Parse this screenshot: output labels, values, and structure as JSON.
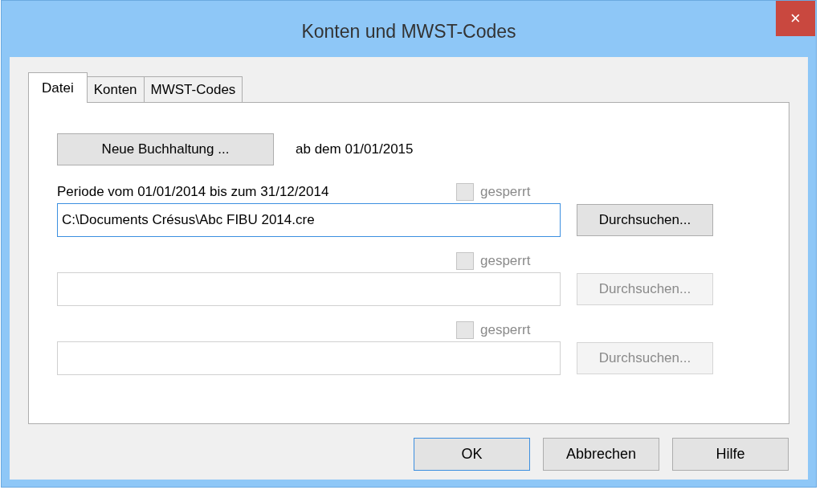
{
  "window": {
    "title": "Konten und MWST-Codes",
    "close": "×"
  },
  "tabs": [
    {
      "label": "Datei",
      "selected": true
    },
    {
      "label": "Konten",
      "selected": false
    },
    {
      "label": "MWST-Codes",
      "selected": false
    }
  ],
  "new_accounting": {
    "button": "Neue Buchhaltung ...",
    "note": "ab dem 01/01/2015"
  },
  "periods": [
    {
      "label": "Periode vom 01/01/2014 bis zum 31/12/2014",
      "locked": {
        "label": "gesperrt",
        "checked": false,
        "disabled": true
      },
      "path": "C:\\Documents Crésus\\Abc FIBU 2014.cre",
      "focused": true,
      "disabled": false,
      "browse": "Durchsuchen..."
    },
    {
      "locked": {
        "label": "gesperrt",
        "checked": false,
        "disabled": true
      },
      "focused": false,
      "disabled": true,
      "browse": "Durchsuchen..."
    },
    {
      "locked": {
        "label": "gesperrt",
        "checked": false,
        "disabled": true
      },
      "focused": false,
      "disabled": true,
      "browse": "Durchsuchen..."
    }
  ],
  "buttons": [
    {
      "label": "OK",
      "default": true
    },
    {
      "label": "Abbrechen",
      "default": false
    },
    {
      "label": "Hilfe",
      "default": false
    }
  ]
}
